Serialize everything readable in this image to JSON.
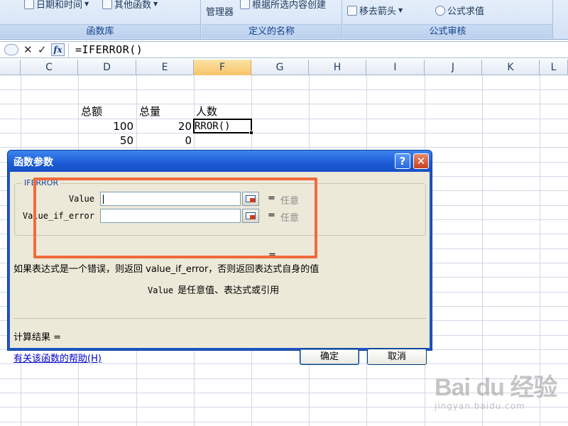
{
  "ribbon": {
    "groups": [
      {
        "title": "函数库",
        "buttons": [
          "日期和时间",
          "其他函数"
        ]
      },
      {
        "title": "定义的名称",
        "buttons": [
          "管理器",
          "根据所选内容创建"
        ]
      },
      {
        "title": "公式审核",
        "buttons": [
          "移去箭头",
          "公式求值"
        ]
      }
    ]
  },
  "formula_bar": {
    "cancel": "✕",
    "enter": "✓",
    "fx": "fx",
    "text": "=IFERROR()"
  },
  "columns": [
    "C",
    "D",
    "E",
    "F",
    "G",
    "H",
    "I",
    "J",
    "K",
    "L"
  ],
  "active_column": "F",
  "cells": {
    "D_header": "总额",
    "E_header": "总量",
    "F_header": "人数",
    "D2": "100",
    "E2": "20",
    "F2": "RROR()",
    "D3": "50",
    "E3": "0"
  },
  "dialog": {
    "title": "函数参数",
    "help_btn": "?",
    "close_btn": "✕",
    "function_name": "IFERROR",
    "args": [
      {
        "label": "Value",
        "value": "任意"
      },
      {
        "label": "Value_if_error",
        "value": "任意"
      }
    ],
    "equals": "=",
    "result_equals": "=",
    "description": "如果表达式是一个错误，则返回 value_if_error，否则返回表达式自身的值",
    "arg_desc_name": "Value",
    "arg_desc_text": "是任意值、表达式或引用",
    "calc_result": "计算结果 =",
    "help_link": "有关该函数的帮助(H)",
    "ok": "确定",
    "cancel": "取消"
  },
  "watermark": {
    "logo": "Bai du 经验",
    "url": "jingyan.baidu.com"
  },
  "colors": {
    "highlight": "#f26a3c",
    "title_bar": "#1c5bd6",
    "active_column": "#f8c36a"
  }
}
